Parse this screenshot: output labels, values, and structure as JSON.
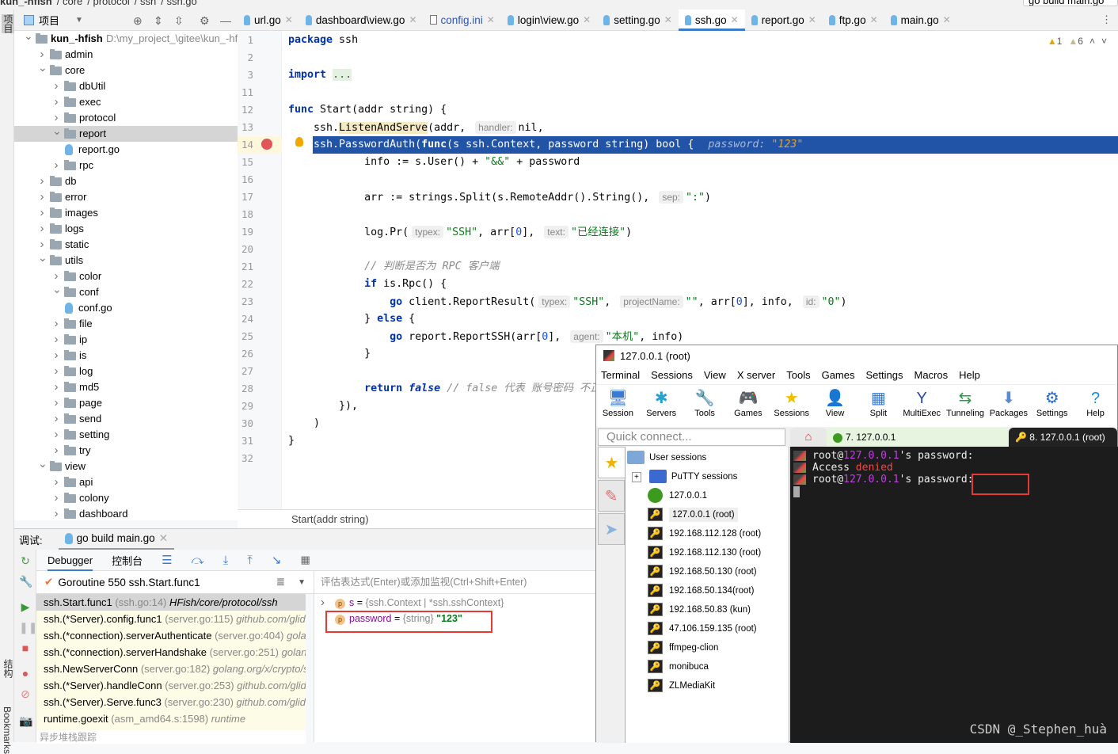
{
  "breadcrumb": [
    "kun_-hfish",
    "core",
    "protocol",
    "ssh",
    "ssh.go"
  ],
  "run_config": "go build main.go",
  "left_strip": {
    "project": "项目",
    "structure": "结构",
    "bookmarks": "Bookmarks"
  },
  "project_panel": {
    "title": "项目"
  },
  "tree": [
    {
      "label": "kun_-hfish",
      "level": 0,
      "type": "folder",
      "open": true,
      "bold": true,
      "path": "D:\\my_project_\\gitee\\kun_-hfish"
    },
    {
      "label": "admin",
      "level": 1,
      "type": "folder",
      "open": false
    },
    {
      "label": "core",
      "level": 1,
      "type": "folder",
      "open": true
    },
    {
      "label": "dbUtil",
      "level": 2,
      "type": "folder",
      "open": false
    },
    {
      "label": "exec",
      "level": 2,
      "type": "folder",
      "open": false
    },
    {
      "label": "protocol",
      "level": 2,
      "type": "folder",
      "open": false
    },
    {
      "label": "report",
      "level": 2,
      "type": "folder",
      "open": true,
      "selected": true
    },
    {
      "label": "report.go",
      "level": 3,
      "type": "file"
    },
    {
      "label": "rpc",
      "level": 2,
      "type": "folder",
      "open": false
    },
    {
      "label": "db",
      "level": 1,
      "type": "folder",
      "open": false
    },
    {
      "label": "error",
      "level": 1,
      "type": "folder",
      "open": false
    },
    {
      "label": "images",
      "level": 1,
      "type": "folder",
      "open": false
    },
    {
      "label": "logs",
      "level": 1,
      "type": "folder",
      "open": false
    },
    {
      "label": "static",
      "level": 1,
      "type": "folder",
      "open": false
    },
    {
      "label": "utils",
      "level": 1,
      "type": "folder",
      "open": true
    },
    {
      "label": "color",
      "level": 2,
      "type": "folder",
      "open": false
    },
    {
      "label": "conf",
      "level": 2,
      "type": "folder",
      "open": true
    },
    {
      "label": "conf.go",
      "level": 3,
      "type": "file"
    },
    {
      "label": "file",
      "level": 2,
      "type": "folder",
      "open": false
    },
    {
      "label": "ip",
      "level": 2,
      "type": "folder",
      "open": false
    },
    {
      "label": "is",
      "level": 2,
      "type": "folder",
      "open": false
    },
    {
      "label": "log",
      "level": 2,
      "type": "folder",
      "open": false
    },
    {
      "label": "md5",
      "level": 2,
      "type": "folder",
      "open": false
    },
    {
      "label": "page",
      "level": 2,
      "type": "folder",
      "open": false
    },
    {
      "label": "send",
      "level": 2,
      "type": "folder",
      "open": false
    },
    {
      "label": "setting",
      "level": 2,
      "type": "folder",
      "open": false
    },
    {
      "label": "try",
      "level": 2,
      "type": "folder",
      "open": false
    },
    {
      "label": "view",
      "level": 1,
      "type": "folder",
      "open": true
    },
    {
      "label": "api",
      "level": 2,
      "type": "folder",
      "open": false
    },
    {
      "label": "colony",
      "level": 2,
      "type": "folder",
      "open": false
    },
    {
      "label": "dashboard",
      "level": 2,
      "type": "folder",
      "open": false
    }
  ],
  "tabs": [
    {
      "label": "url.go",
      "icon": "go"
    },
    {
      "label": "dashboard\\view.go",
      "icon": "go"
    },
    {
      "label": "config.ini",
      "icon": "file"
    },
    {
      "label": "login\\view.go",
      "icon": "go"
    },
    {
      "label": "setting.go",
      "icon": "go"
    },
    {
      "label": "ssh.go",
      "icon": "go",
      "active": true
    },
    {
      "label": "report.go",
      "icon": "go"
    },
    {
      "label": "ftp.go",
      "icon": "go"
    },
    {
      "label": "main.go",
      "icon": "go"
    }
  ],
  "inspections": {
    "errors": "1",
    "warnings": "6"
  },
  "code": [
    {
      "num": "1",
      "tokens": [
        [
          "package",
          "k"
        ],
        [
          " ssh",
          ""
        ]
      ]
    },
    {
      "num": "2",
      "tokens": []
    },
    {
      "num": "3",
      "tokens": [
        [
          "import",
          "k"
        ],
        [
          " ",
          ""
        ],
        [
          "...",
          "fd"
        ]
      ]
    },
    {
      "num": "11",
      "tokens": []
    },
    {
      "num": "12",
      "tokens": [
        [
          "func",
          "k"
        ],
        [
          " Start(addr string) {",
          ""
        ]
      ]
    },
    {
      "num": "13",
      "tokens": [
        [
          "    ssh.",
          ""
        ],
        [
          "ListenAndServe",
          "hl"
        ],
        [
          "(addr, ",
          ""
        ],
        [
          "handler:",
          "h"
        ],
        [
          "nil,",
          ""
        ]
      ]
    },
    {
      "num": "14",
      "current": true,
      "tokens": [
        [
          "    ssh.PasswordAuth(",
          ""
        ],
        [
          "func",
          "k"
        ],
        [
          "(s ssh.Context, password string) bool {",
          ""
        ],
        [
          "password: ",
          "dh"
        ],
        [
          "\"123\"",
          "dv"
        ]
      ]
    },
    {
      "num": "15",
      "tokens": [
        [
          "            info := s.User() + ",
          ""
        ],
        [
          "\"&&\"",
          "s"
        ],
        [
          " + password",
          ""
        ]
      ]
    },
    {
      "num": "16",
      "tokens": []
    },
    {
      "num": "17",
      "tokens": [
        [
          "            arr := strings.Split(s.RemoteAddr().String(), ",
          ""
        ],
        [
          "sep:",
          "h"
        ],
        [
          "\":\"",
          "s"
        ],
        [
          ")",
          ""
        ]
      ]
    },
    {
      "num": "18",
      "tokens": []
    },
    {
      "num": "19",
      "tokens": [
        [
          "            log.Pr(",
          ""
        ],
        [
          "typex:",
          "h"
        ],
        [
          "\"SSH\"",
          "s"
        ],
        [
          ", arr[",
          ""
        ],
        [
          "0",
          "n"
        ],
        [
          "], ",
          ""
        ],
        [
          "text:",
          "h"
        ],
        [
          "\"已经连接\"",
          "s"
        ],
        [
          ")",
          ""
        ]
      ]
    },
    {
      "num": "20",
      "tokens": []
    },
    {
      "num": "21",
      "tokens": [
        [
          "            ",
          ""
        ],
        [
          "// 判断是否为 RPC 客户端",
          "c"
        ]
      ]
    },
    {
      "num": "22",
      "tokens": [
        [
          "            ",
          ""
        ],
        [
          "if",
          "k"
        ],
        [
          " is.Rpc() {",
          ""
        ]
      ]
    },
    {
      "num": "23",
      "tokens": [
        [
          "                ",
          ""
        ],
        [
          "go",
          "k"
        ],
        [
          " client.ReportResult(",
          ""
        ],
        [
          "typex:",
          "h"
        ],
        [
          "\"SSH\"",
          "s"
        ],
        [
          ", ",
          ""
        ],
        [
          "projectName:",
          "h"
        ],
        [
          "\"\"",
          "s"
        ],
        [
          ", arr[",
          ""
        ],
        [
          "0",
          "n"
        ],
        [
          "], info, ",
          ""
        ],
        [
          "id:",
          "h"
        ],
        [
          "\"0\"",
          "s"
        ],
        [
          ")",
          ""
        ]
      ]
    },
    {
      "num": "24",
      "tokens": [
        [
          "            } ",
          ""
        ],
        [
          "else",
          "k"
        ],
        [
          " {",
          ""
        ]
      ]
    },
    {
      "num": "25",
      "tokens": [
        [
          "                ",
          ""
        ],
        [
          "go",
          "k"
        ],
        [
          " report.ReportSSH(arr[",
          ""
        ],
        [
          "0",
          "n"
        ],
        [
          "], ",
          ""
        ],
        [
          "agent:",
          "h"
        ],
        [
          "\"本机\"",
          "s"
        ],
        [
          ", info)",
          ""
        ]
      ]
    },
    {
      "num": "26",
      "tokens": [
        [
          "            }",
          ""
        ]
      ]
    },
    {
      "num": "27",
      "tokens": []
    },
    {
      "num": "28",
      "tokens": [
        [
          "            ",
          ""
        ],
        [
          "return",
          "k"
        ],
        [
          " ",
          ""
        ],
        [
          "false",
          "kf"
        ],
        [
          " ",
          ""
        ],
        [
          "// false 代表 账号密码 不正",
          "c"
        ]
      ]
    },
    {
      "num": "29",
      "tokens": [
        [
          "        }),",
          ""
        ]
      ]
    },
    {
      "num": "30",
      "tokens": [
        [
          "    )",
          ""
        ]
      ]
    },
    {
      "num": "31",
      "tokens": [
        [
          "}",
          ""
        ]
      ]
    },
    {
      "num": "32",
      "tokens": []
    }
  ],
  "editor_breadcrumb": "Start(addr string)",
  "debug": {
    "label": "调试:",
    "session_tab": "go build main.go",
    "tabs": {
      "debugger": "Debugger",
      "console": "控制台"
    },
    "goroutine": "Goroutine 550 ssh.Start.func1",
    "frames": [
      {
        "name": "ssh.Start.func1",
        "loc": "(ssh.go:14)",
        "pkg": "HFish/core/protocol/ssh",
        "selected": true
      },
      {
        "name": "ssh.(*Server).config.func1",
        "loc": "(server.go:115)",
        "pkg": "github.com/glider"
      },
      {
        "name": "ssh.(*connection).serverAuthenticate",
        "loc": "(server.go:404)",
        "pkg": "golang"
      },
      {
        "name": "ssh.(*connection).serverHandshake",
        "loc": "(server.go:251)",
        "pkg": "golang."
      },
      {
        "name": "ssh.NewServerConn",
        "loc": "(server.go:182)",
        "pkg": "golang.org/x/crypto/s"
      },
      {
        "name": "ssh.(*Server).handleConn",
        "loc": "(server.go:253)",
        "pkg": "github.com/glider"
      },
      {
        "name": "ssh.(*Server).Serve.func3",
        "loc": "(server.go:230)",
        "pkg": "github.com/glider"
      },
      {
        "name": "runtime.goexit",
        "loc": "(asm_amd64.s:1598)",
        "pkg": "runtime"
      }
    ],
    "async_label": "异步堆栈跟踪",
    "eval_placeholder": "评估表达式(Enter)或添加监视(Ctrl+Shift+Enter)",
    "variables": [
      {
        "badge": "p",
        "name": "s",
        "type": "{ssh.Context | *ssh.sshContext}",
        "value": "",
        "expandable": true
      },
      {
        "badge": "p",
        "name": "password",
        "type": "{string}",
        "value": "\"123\""
      }
    ]
  },
  "moba": {
    "title": "127.0.0.1 (root)",
    "menu": [
      "Terminal",
      "Sessions",
      "View",
      "X server",
      "Tools",
      "Games",
      "Settings",
      "Macros",
      "Help"
    ],
    "toolbar": [
      {
        "label": "Session",
        "icon": "🖥"
      },
      {
        "label": "Servers",
        "icon": "✱"
      },
      {
        "label": "Tools",
        "icon": "🔧"
      },
      {
        "label": "Games",
        "icon": "🎮"
      },
      {
        "label": "Sessions",
        "icon": "★"
      },
      {
        "label": "View",
        "icon": "👤"
      },
      {
        "label": "Split",
        "icon": "▦"
      },
      {
        "label": "MultiExec",
        "icon": "Y"
      },
      {
        "label": "Tunneling",
        "icon": "⇆"
      },
      {
        "label": "Packages",
        "icon": "⬇"
      },
      {
        "label": "Settings",
        "icon": "⚙"
      },
      {
        "label": "Help",
        "icon": "?"
      }
    ],
    "quick_connect_placeholder": "Quick connect...",
    "tabs": [
      {
        "label": "7. 127.0.0.1"
      },
      {
        "label": "8. 127.0.0.1 (root)",
        "active": true
      }
    ],
    "sessions_root": "User sessions",
    "putty": "PuTTY sessions",
    "sessions": [
      {
        "label": "127.0.0.1",
        "icon": "globe"
      },
      {
        "label": "127.0.0.1 (root)",
        "icon": "key",
        "selected": true
      },
      {
        "label": "192.168.112.128 (root)",
        "icon": "key"
      },
      {
        "label": "192.168.112.130 (root)",
        "icon": "key"
      },
      {
        "label": "192.168.50.130 (root)",
        "icon": "key"
      },
      {
        "label": "192.168.50.134(root)",
        "icon": "key"
      },
      {
        "label": "192.168.50.83 (kun)",
        "icon": "key"
      },
      {
        "label": "47.106.159.135 (root)",
        "icon": "key"
      },
      {
        "label": "ffmpeg-clion",
        "icon": "key"
      },
      {
        "label": "monibuca",
        "icon": "key"
      },
      {
        "label": "ZLMediaKit",
        "icon": "key"
      }
    ],
    "terminal": [
      [
        [
          "root@",
          ""
        ],
        [
          "127.0.0.1",
          "mag"
        ],
        [
          "'s password:",
          ""
        ]
      ],
      [
        [
          "Access ",
          ""
        ],
        [
          "denied",
          "red"
        ]
      ],
      [
        [
          "root@",
          ""
        ],
        [
          "127.0.0.1",
          "mag"
        ],
        [
          "'s password:",
          ""
        ]
      ]
    ],
    "watermark": "CSDN @_Stephen_huà"
  }
}
